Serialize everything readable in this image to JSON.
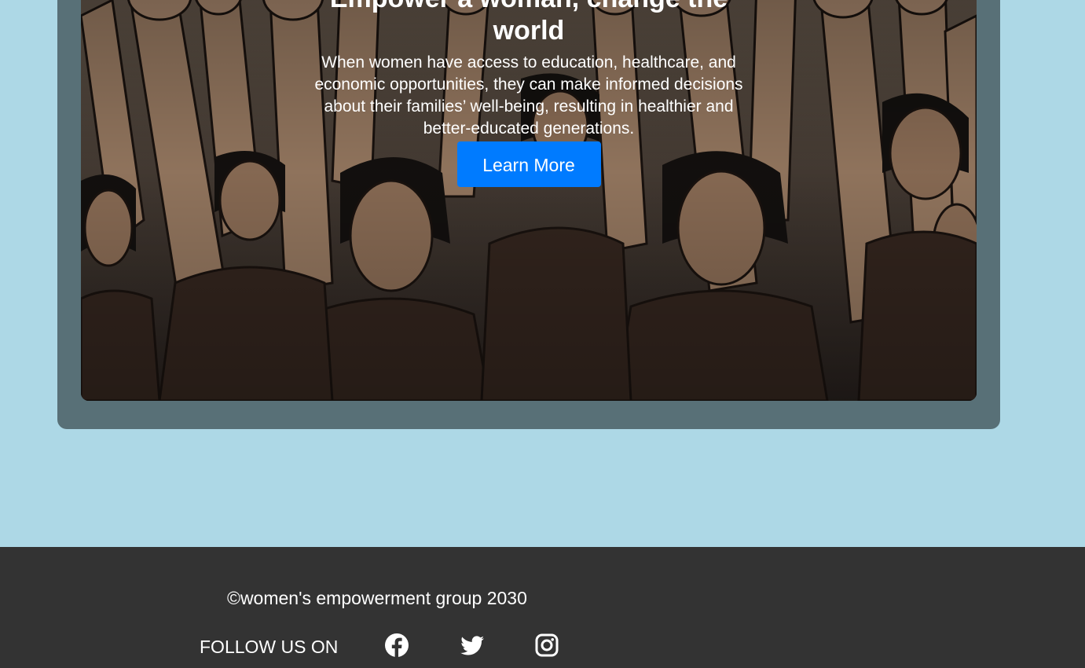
{
  "hero": {
    "title": "Empower a woman, change the world",
    "text": "When women have access to education, healthcare, and economic opportunities, they can make informed decisions about their families’ well-being, resulting in healthier and better-educated generations.",
    "button_label": "Learn More",
    "accent_color": "#007bff"
  },
  "footer": {
    "copyright": "©women's empowerment group 2030",
    "follow_label": "FOLLOW US ON",
    "social": [
      {
        "icon": "facebook-icon"
      },
      {
        "icon": "twitter-icon"
      },
      {
        "icon": "instagram-icon"
      }
    ]
  },
  "colors": {
    "page_background": "#add8e6",
    "card_background": "#587077",
    "footer_background": "#333333"
  }
}
